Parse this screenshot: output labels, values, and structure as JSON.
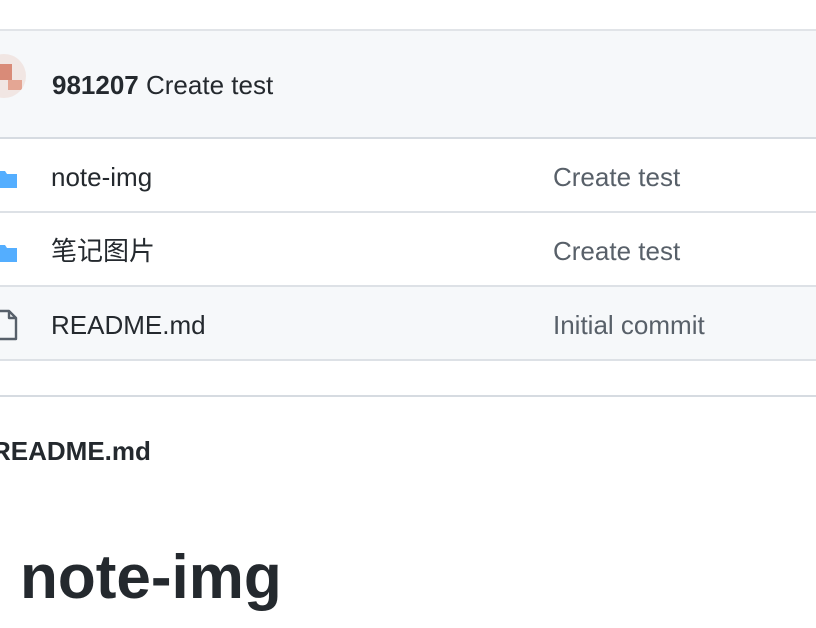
{
  "latest_commit": {
    "hash": "981207",
    "message": "Create test"
  },
  "files": [
    {
      "type": "folder",
      "icon": "folder-icon",
      "name": "note-img",
      "commit_message": "Create test"
    },
    {
      "type": "folder",
      "icon": "folder-icon",
      "name": "笔记图片",
      "commit_message": "Create test"
    },
    {
      "type": "file",
      "icon": "file-icon",
      "name": "README.md",
      "commit_message": "Initial commit"
    }
  ],
  "readme": {
    "filename": "README.md",
    "heading": "note-img"
  },
  "colors": {
    "folder": "#54aeff",
    "header_bg": "#f6f8fa",
    "text": "#24292e",
    "muted_text": "#586069"
  }
}
